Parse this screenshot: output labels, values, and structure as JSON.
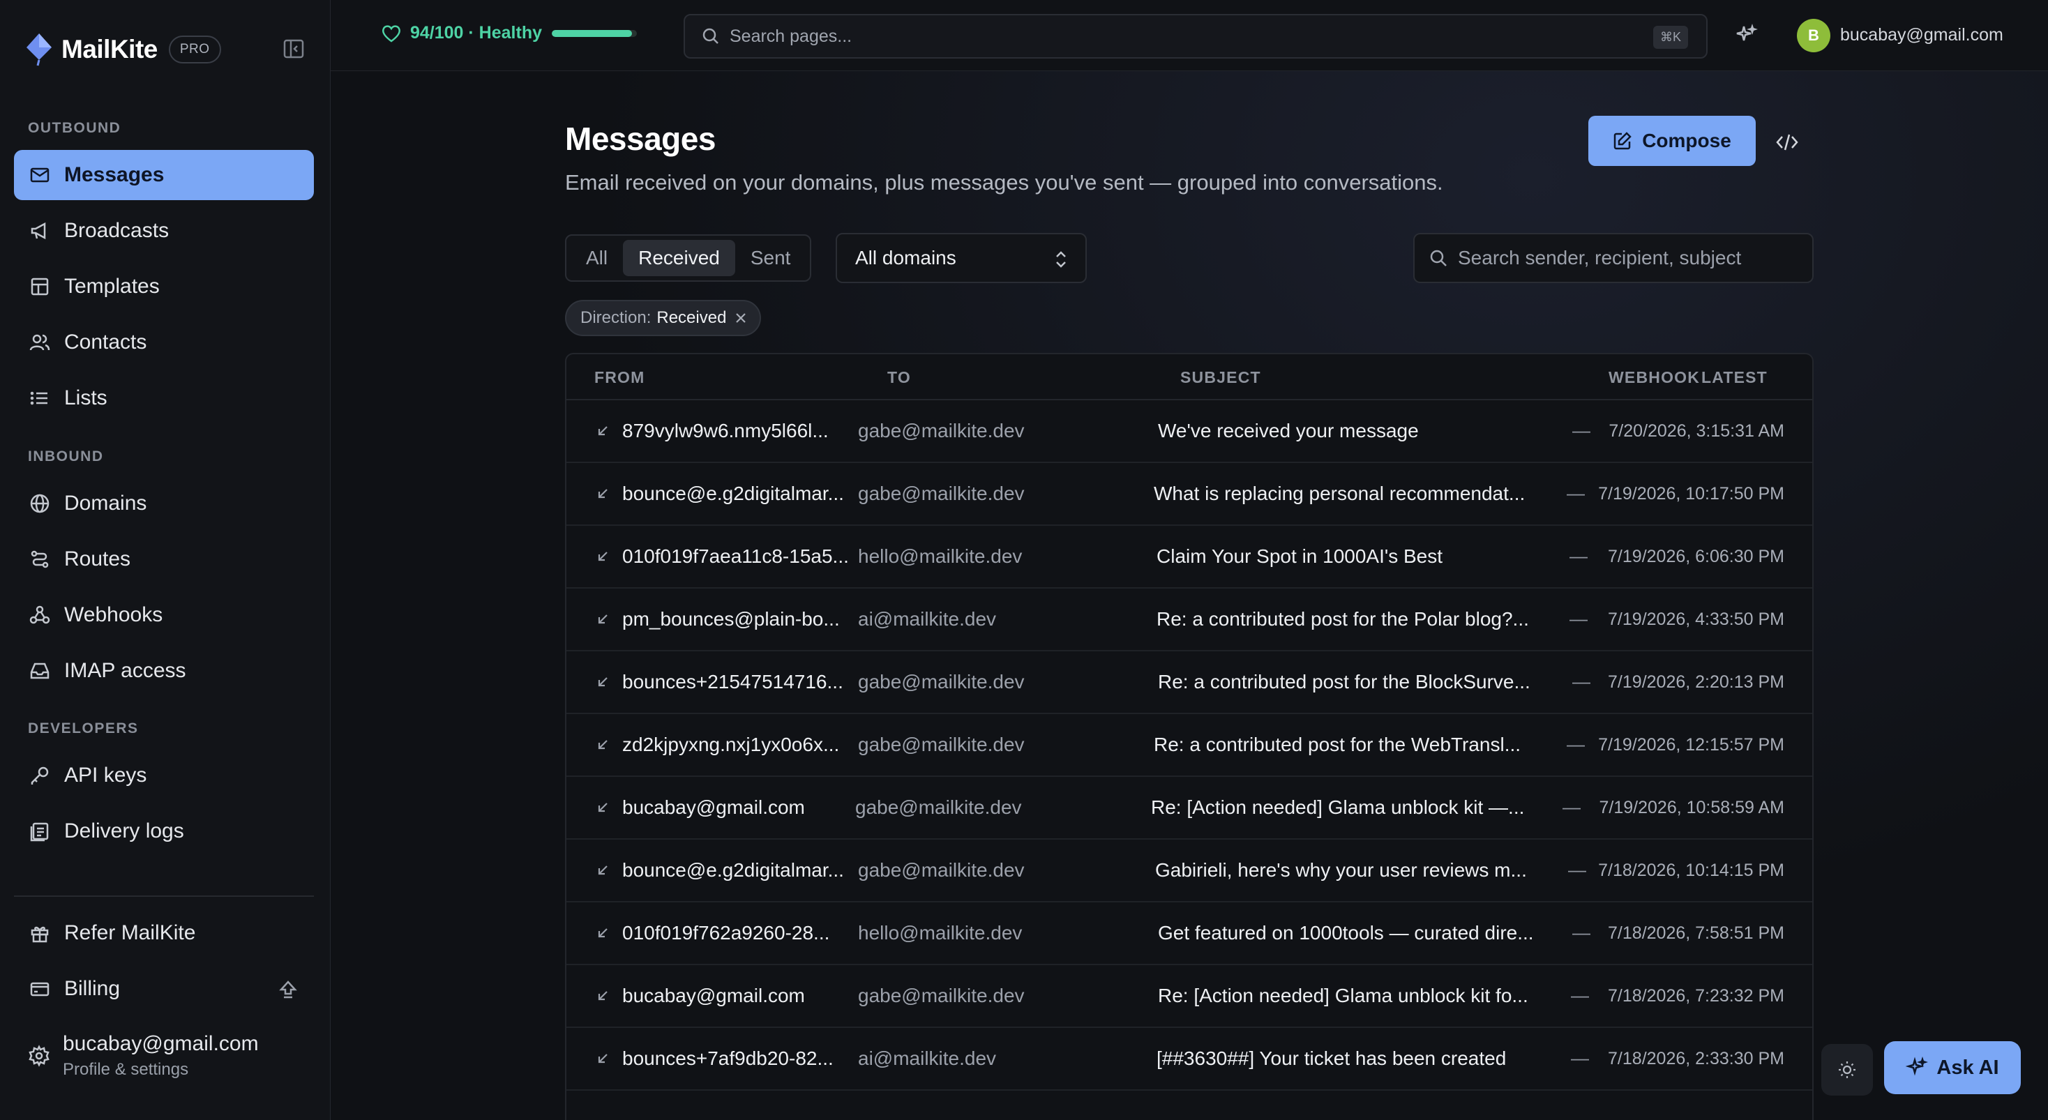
{
  "app": {
    "name": "MailKite",
    "badge": "PRO"
  },
  "sidebar": {
    "sections": [
      {
        "label": "OUTBOUND",
        "items": [
          {
            "label": "Messages",
            "icon": "mail-icon",
            "active": true
          },
          {
            "label": "Broadcasts",
            "icon": "megaphone-icon"
          },
          {
            "label": "Templates",
            "icon": "template-icon"
          },
          {
            "label": "Contacts",
            "icon": "users-icon"
          },
          {
            "label": "Lists",
            "icon": "list-icon"
          }
        ]
      },
      {
        "label": "INBOUND",
        "items": [
          {
            "label": "Domains",
            "icon": "globe-icon"
          },
          {
            "label": "Routes",
            "icon": "route-icon"
          },
          {
            "label": "Webhooks",
            "icon": "webhook-icon"
          },
          {
            "label": "IMAP access",
            "icon": "inbox-icon"
          }
        ]
      },
      {
        "label": "DEVELOPERS",
        "items": [
          {
            "label": "API keys",
            "icon": "key-icon"
          },
          {
            "label": "Delivery logs",
            "icon": "logs-icon"
          }
        ]
      }
    ],
    "footer": [
      {
        "label": "Refer MailKite",
        "icon": "gift-icon"
      },
      {
        "label": "Billing",
        "icon": "credit-card-icon"
      }
    ],
    "profile": {
      "email": "bucabay@gmail.com",
      "sub": "Profile & settings"
    }
  },
  "topbar": {
    "health": {
      "label": "94/100 · Healthy",
      "score": 0.94
    },
    "search_placeholder": "Search pages...",
    "shortcut": "⌘K",
    "avatar_initial": "B",
    "user_email": "bucabay@gmail.com"
  },
  "page": {
    "title": "Messages",
    "subtitle": "Email received on your domains, plus messages you've sent — grouped into conversations.",
    "compose_label": "Compose",
    "filters": {
      "options": [
        "All",
        "Received",
        "Sent"
      ],
      "selected": "Received"
    },
    "domain_select": "All domains",
    "search_placeholder": "Search sender, recipient, subject",
    "chip": {
      "key": "Direction:",
      "value": "Received"
    }
  },
  "table": {
    "columns": [
      "FROM",
      "TO",
      "SUBJECT",
      "WEBHOOK",
      "LATEST"
    ],
    "rows": [
      {
        "from": "879vylw9w6.nmy5l66l...",
        "to": "gabe@mailkite.dev",
        "subject": "We've received your message",
        "webhook": "—",
        "latest": "7/20/2026, 3:15:31 AM"
      },
      {
        "from": "bounce@e.g2digitalmar...",
        "to": "gabe@mailkite.dev",
        "subject": "What is replacing personal recommendat...",
        "webhook": "—",
        "latest": "7/19/2026, 10:17:50 PM"
      },
      {
        "from": "010f019f7aea11c8-15a5...",
        "to": "hello@mailkite.dev",
        "subject": "Claim Your Spot in 1000AI's Best",
        "webhook": "—",
        "latest": "7/19/2026, 6:06:30 PM"
      },
      {
        "from": "pm_bounces@plain-bo...",
        "to": "ai@mailkite.dev",
        "subject": "Re: a contributed post for the Polar blog?...",
        "webhook": "—",
        "latest": "7/19/2026, 4:33:50 PM"
      },
      {
        "from": "bounces+21547514716...",
        "to": "gabe@mailkite.dev",
        "subject": "Re: a contributed post for the BlockSurve...",
        "webhook": "—",
        "latest": "7/19/2026, 2:20:13 PM"
      },
      {
        "from": "zd2kjpyxng.nxj1yx0o6x...",
        "to": "gabe@mailkite.dev",
        "subject": "Re: a contributed post for the WebTransl...",
        "webhook": "—",
        "latest": "7/19/2026, 12:15:57 PM"
      },
      {
        "from": "bucabay@gmail.com",
        "to": "gabe@mailkite.dev",
        "subject": "Re: [Action needed] Glama unblock kit —...",
        "webhook": "—",
        "latest": "7/19/2026, 10:58:59 AM"
      },
      {
        "from": "bounce@e.g2digitalmar...",
        "to": "gabe@mailkite.dev",
        "subject": "Gabirieli, here's why your user reviews m...",
        "webhook": "—",
        "latest": "7/18/2026, 10:14:15 PM"
      },
      {
        "from": "010f019f762a9260-28...",
        "to": "hello@mailkite.dev",
        "subject": "Get featured on 1000tools — curated dire...",
        "webhook": "—",
        "latest": "7/18/2026, 7:58:51 PM"
      },
      {
        "from": "bucabay@gmail.com",
        "to": "gabe@mailkite.dev",
        "subject": "Re: [Action needed] Glama unblock kit fo...",
        "webhook": "—",
        "latest": "7/18/2026, 7:23:32 PM"
      },
      {
        "from": "bounces+7af9db20-82...",
        "to": "ai@mailkite.dev",
        "subject": "[##3630##] Your ticket has been created",
        "webhook": "—",
        "latest": "7/18/2026, 2:33:30 PM"
      }
    ]
  },
  "ask_ai_label": "Ask AI",
  "colors": {
    "accent": "#7ba7f5",
    "health": "#4ed3a5",
    "background": "#0f1115"
  }
}
